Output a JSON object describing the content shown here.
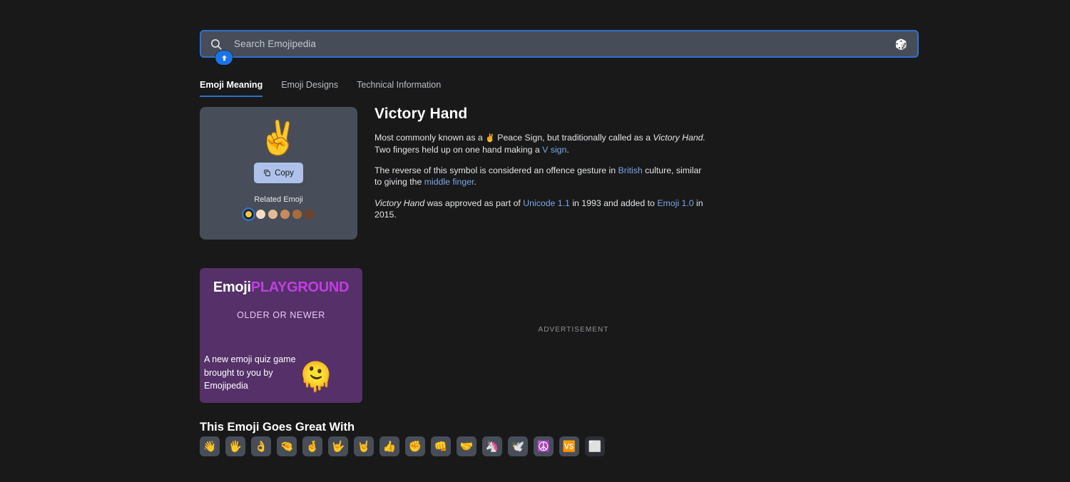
{
  "search": {
    "placeholder": "Search Emojipedia",
    "value": "",
    "icon": "search-icon",
    "random_icon": "dice-icon",
    "random_glyph": "🎲"
  },
  "cursor_badge": {
    "icon": "shift-arrow-icon"
  },
  "tabs": [
    {
      "label": "Emoji Meaning",
      "active": true
    },
    {
      "label": "Emoji Designs",
      "active": false
    },
    {
      "label": "Technical Information",
      "active": false
    }
  ],
  "emoji_card": {
    "glyph": "✌️",
    "copy_label": "Copy",
    "copy_icon": "copy-icon",
    "related_label": "Related Emoji",
    "swatches": [
      {
        "name": "default-yellow",
        "color": "#f5c542",
        "selected": true
      },
      {
        "name": "light-skin-tone",
        "color": "#f6ddc5",
        "selected": false
      },
      {
        "name": "medium-light-skin-tone",
        "color": "#e2bb95",
        "selected": false
      },
      {
        "name": "medium-skin-tone",
        "color": "#c68a5e",
        "selected": false
      },
      {
        "name": "medium-dark-skin-tone",
        "color": "#a96c3a",
        "selected": false
      },
      {
        "name": "dark-skin-tone",
        "color": "#6e4326",
        "selected": false
      }
    ]
  },
  "article": {
    "title": "Victory Hand",
    "p1_a": "Most commonly known as a ",
    "p1_emoji": "✌️",
    "p1_b": " Peace Sign, but traditionally called as a ",
    "p1_em1": "Victory Hand.",
    "p1_c": " Two fingers held up on one hand making a ",
    "p1_link": "V sign",
    "p1_d": ".",
    "p2_a": "The reverse of this symbol is considered an offence gesture in ",
    "p2_link1": "British",
    "p2_b": " culture, similar to giving the ",
    "p2_link2": "middle finger",
    "p2_c": ".",
    "p3_em": "Victory Hand",
    "p3_a": " was approved as part of ",
    "p3_link1": "Unicode 1.1",
    "p3_b": " in 1993 and added to ",
    "p3_link2": "Emoji 1.0",
    "p3_c": " in 2015."
  },
  "playground": {
    "logo_part1": "Emoji",
    "logo_part2": "PLAYGROUND",
    "subtitle": "OLDER OR NEWER",
    "body": "A new emoji quiz game brought to you by Emojipedia",
    "art": "🫠",
    "bg_color": "#553069",
    "accent_color": "#c23ee0"
  },
  "advertisement": {
    "label": "ADVERTISEMENT"
  },
  "goes_great_with": {
    "title": "This Emoji Goes Great With",
    "items": [
      {
        "name": "waving-hand-emoji",
        "glyph": "👋",
        "dark": false
      },
      {
        "name": "hand-with-fingers-splayed-emoji",
        "glyph": "🖐️",
        "dark": false
      },
      {
        "name": "ok-hand-emoji",
        "glyph": "👌",
        "dark": false
      },
      {
        "name": "pinching-hand-emoji",
        "glyph": "🤏",
        "dark": false
      },
      {
        "name": "crossed-fingers-emoji",
        "glyph": "🤞",
        "dark": false
      },
      {
        "name": "love-you-gesture-emoji",
        "glyph": "🤟",
        "dark": false
      },
      {
        "name": "sign-of-the-horns-emoji",
        "glyph": "🤘",
        "dark": false
      },
      {
        "name": "thumbs-up-emoji",
        "glyph": "👍",
        "dark": false
      },
      {
        "name": "raised-fist-emoji",
        "glyph": "✊",
        "dark": false
      },
      {
        "name": "oncoming-fist-emoji",
        "glyph": "👊",
        "dark": false
      },
      {
        "name": "handshake-emoji",
        "glyph": "🤝",
        "dark": false
      },
      {
        "name": "unicorn-emoji",
        "glyph": "🦄",
        "dark": false
      },
      {
        "name": "dove-emoji",
        "glyph": "🕊️",
        "dark": false
      },
      {
        "name": "peace-symbol-emoji",
        "glyph": "☮️",
        "dark": false
      },
      {
        "name": "vs-button-emoji",
        "glyph": "🆚",
        "dark": false
      },
      {
        "name": "white-square-emoji",
        "glyph": "⬜",
        "dark": true
      }
    ]
  },
  "colors": {
    "page_bg": "#191919",
    "panel_bg": "#474e59",
    "accent_blue": "#2f6fd0",
    "link_blue": "#7ba7e8",
    "copy_btn_bg": "#aec1ea"
  }
}
